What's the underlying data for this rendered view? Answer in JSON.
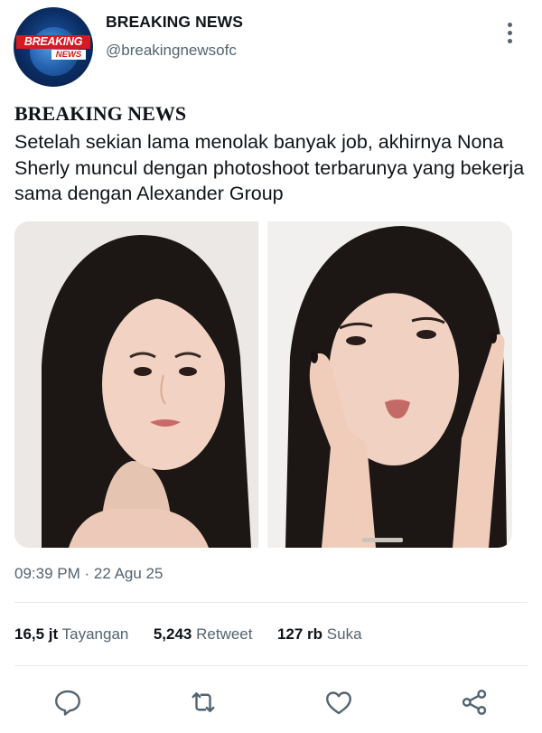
{
  "account": {
    "name": "BREAKING NEWS",
    "handle": "@breakingnewsofc",
    "avatar_logo_top": "BREAKING",
    "avatar_logo_bottom": "NEWS"
  },
  "tweet": {
    "headline": "BREAKING NEWS",
    "text": "Setelah sekian lama menolak banyak job, akhirnya Nona Sherly muncul dengan photoshoot terbarunya yang bekerja sama dengan Alexander Group",
    "timestamp": "09:39 PM · 22 Agu 25"
  },
  "stats": {
    "views_value": "16,5 jt",
    "views_label": "Tayangan",
    "retweets_value": "5,243",
    "retweets_label": "Retweet",
    "likes_value": "127 rb",
    "likes_label": "Suka"
  },
  "actions": [
    "reply-icon",
    "retweet-icon",
    "like-icon",
    "share-icon"
  ],
  "colors": {
    "text_primary": "#0f1419",
    "text_secondary": "#536471",
    "brand_red": "#d71920",
    "divider": "#e6e9ec"
  }
}
